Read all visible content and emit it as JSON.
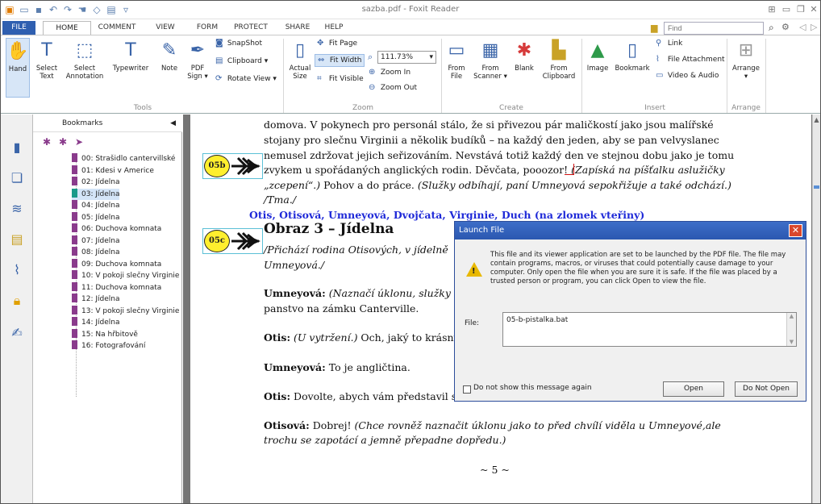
{
  "window": {
    "title": "sazba.pdf - Foxit Reader"
  },
  "tabs": [
    "FILE",
    "HOME",
    "COMMENT",
    "VIEW",
    "FORM",
    "PROTECT",
    "SHARE",
    "HELP"
  ],
  "search": {
    "placeholder": "Find"
  },
  "ribbon": {
    "tools": {
      "hand": "Hand",
      "select_text": "Select Text",
      "select_annotation": "Select Annotation",
      "typewriter": "Typewriter",
      "note": "Note",
      "pdf_sign": "PDF Sign ▾",
      "snapshot": "SnapShot",
      "clipboard": "Clipboard ▾",
      "rotate_view": "Rotate View ▾",
      "group": "Tools"
    },
    "zoom": {
      "actual_size": "Actual Size",
      "fit_page": "Fit Page",
      "fit_width": "Fit Width",
      "fit_visible": "Fit Visible",
      "zoom_level": "111.73%",
      "zoom_in": "Zoom In",
      "zoom_out": "Zoom Out",
      "group": "Zoom"
    },
    "create": {
      "from_file": "From File",
      "from_scanner": "From Scanner ▾",
      "blank": "Blank",
      "from_clipboard": "From Clipboard",
      "group": "Create"
    },
    "insert": {
      "image": "Image",
      "bookmark": "Bookmark",
      "link": "Link",
      "file_attachment": "File Attachment",
      "video_audio": "Video & Audio",
      "group": "Insert"
    },
    "arrange": {
      "arrange": "Arrange",
      "group": "Arrange"
    }
  },
  "bookmarks": {
    "title": "Bookmarks",
    "items": [
      "00: Strašidlo cantervillské",
      "01: Kdesi v Americe",
      "02: Jídelna",
      "03: Jídelna",
      "04: Jídelna",
      "05: Jídelna",
      "06: Duchova komnata",
      "07: Jídelna",
      "08: Jídelna",
      "09: Duchova komnata",
      "10: V pokoji slečny Virginie",
      "11: Duchova komnata",
      "12: Jídelna",
      "13: V pokoji slečny Virginie",
      "14: Jídelna",
      "15: Na hřbitově",
      "16: Fotografování"
    ],
    "selected_index": 3
  },
  "document": {
    "l1": "domova. V pokynech pro personál stálo, že si přivezou pár maličkostí jako jsou malířské",
    "l2": "stojany pro slečnu Virginii a několik budíků – na každý den jeden, aby se pan velvyslanec",
    "l3": "nemusel zdržovat jejich seřizováním. Nevstává totiž každý den ve stejnou dobu jako je tomu",
    "l4a": "zvykem u spořádaných anglických rodin. Děvčata, pooozor!",
    "l4b": " (Zapíská na píšťalku asluži­čky",
    "l5a": "„zcepení“.)",
    "l5b": " Pohov a do práce. ",
    "l5c": "(Služky odbíhají, paní Umneyová sepokřižuje a také odchází.)",
    "l6": "/Tma./",
    "cast": "Otis, Otisová, Umneyová, Dvojčata, Virginie, Duch (na zlomek vteřiny)",
    "heading": "Obraz 3 – Jídelna",
    "p1a": "/Přichází rodina Otisových, v jídelně",
    "p1b": "Umneyová./",
    "p2a_b": "Umneyová:",
    "p2a_i": " (Naznačí úklonu, služky",
    "p2b": "panstvo na zámku Canterville.",
    "p3_b": "Otis:",
    "p3_i": " (U vytržení.)",
    "p3_t": " Och, jaký to krásný",
    "p4_b": "Umneyová:",
    "p4_t": " To je angličtina.",
    "p5_b": "Otis:",
    "p5_t": " Dovolte, abych vám představil s",
    "p6_b": "Otisová:",
    "p6_t": " Dobrej! ",
    "p6_i": "(Chce rovněž naznačit úklonu jako to před chvílí viděla u Umneyové,ale",
    "p7": "trochu se zapotácí a jemně přepadne dopředu.)",
    "pagenum": "~ 5 ~",
    "marker1": "05b",
    "marker2": "05c"
  },
  "dialog": {
    "title": "Launch File",
    "message": "This file and its viewer application are set to be launched by the PDF file. The file may contain programs, macros, or viruses that could potentially cause damage to your computer. Only open the file when you are sure it is safe. If the file was placed by a trusted person or program, you can click Open to view the file.",
    "file_label": "File:",
    "file_value": "05-b-pistalka.bat",
    "checkbox_label": "Do not show this message again",
    "open_button": "Open",
    "donotopen_button": "Do Not Open"
  }
}
